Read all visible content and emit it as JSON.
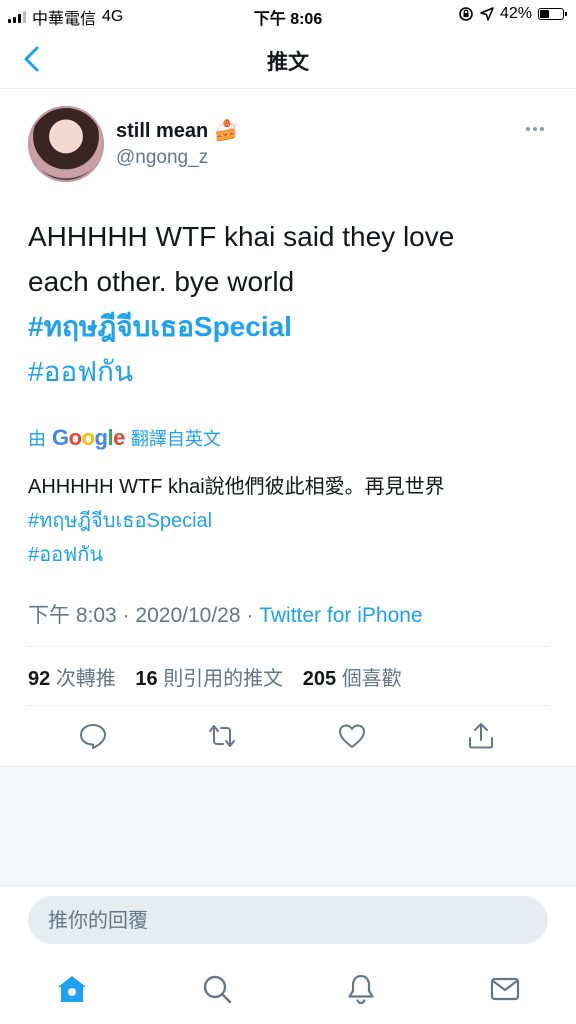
{
  "status_bar": {
    "carrier": "中華電信",
    "network": "4G",
    "time": "下午 8:06",
    "battery": "42%",
    "battery_level": 0.42
  },
  "header": {
    "title": "推文"
  },
  "tweet": {
    "author_name": "still mean",
    "author_emoji": "🍰",
    "author_handle": "@ngong_z",
    "text_lines": [
      "AHHHHH WTF khai said they love",
      "each other. bye world"
    ],
    "hashtags": [
      "#ทฤษฎีจีบเธอSpecial",
      "#ออฟกัน"
    ],
    "translation_prefix": "由",
    "translation_brand": "Google",
    "translation_suffix": "翻譯自英文",
    "translated_text": "AHHHHH WTF khai說他們彼此相愛。再見世界",
    "translated_hashtags": [
      "#ทฤษฎีจีบเธอSpecial",
      "#ออฟกัน"
    ],
    "time": "下午 8:03",
    "separator": "·",
    "date": "2020/10/28",
    "source": "Twitter for iPhone"
  },
  "stats": {
    "retweets_count": "92",
    "retweets_label": "次轉推",
    "quotes_count": "16",
    "quotes_label": "則引用的推文",
    "likes_count": "205",
    "likes_label": "個喜歡"
  },
  "reply": {
    "placeholder": "推你的回覆"
  },
  "icons": {
    "back": "chevron-left-icon",
    "more": "more-horizontal-icon",
    "reply": "reply-icon",
    "retweet": "retweet-icon",
    "like": "heart-icon",
    "share": "share-icon",
    "home": "home-icon",
    "search": "search-icon",
    "notifications": "bell-icon",
    "messages": "mail-icon"
  },
  "colors": {
    "accent": "#1da1f2",
    "text": "#14171a",
    "secondary": "#657786",
    "border": "#e6ecf0",
    "icon": "#657786"
  }
}
